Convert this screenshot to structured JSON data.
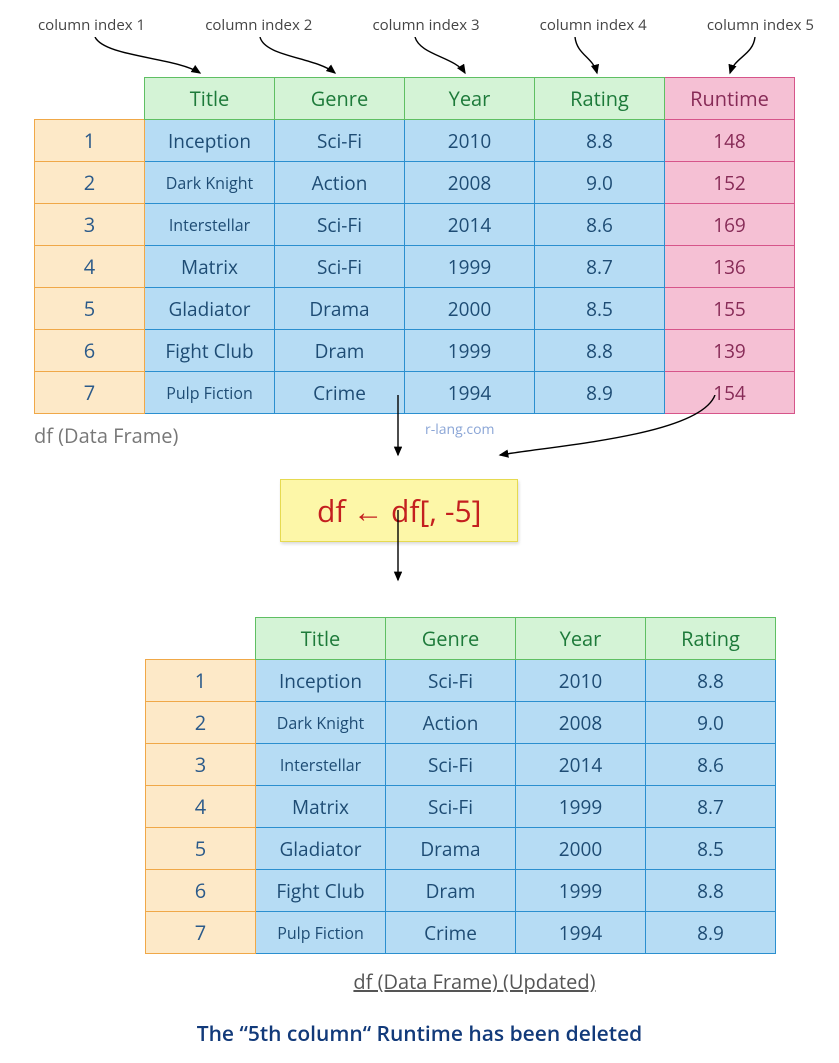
{
  "col_index_labels": [
    "column index 1",
    "column index 2",
    "column index 3",
    "column index 4",
    "column index 5"
  ],
  "table1": {
    "headers": [
      "Title",
      "Genre",
      "Year",
      "Rating",
      "Runtime"
    ],
    "rows": [
      {
        "idx": "1",
        "cells": [
          "Inception",
          "Sci-Fi",
          "2010",
          "8.8",
          "148"
        ]
      },
      {
        "idx": "2",
        "cells": [
          "Dark Knight",
          "Action",
          "2008",
          "9.0",
          "152"
        ]
      },
      {
        "idx": "3",
        "cells": [
          "Interstellar",
          "Sci-Fi",
          "2014",
          "8.6",
          "169"
        ]
      },
      {
        "idx": "4",
        "cells": [
          "Matrix",
          "Sci-Fi",
          "1999",
          "8.7",
          "136"
        ]
      },
      {
        "idx": "5",
        "cells": [
          "Gladiator",
          "Drama",
          "2000",
          "8.5",
          "155"
        ]
      },
      {
        "idx": "6",
        "cells": [
          "Fight Club",
          "Dram",
          "1999",
          "8.8",
          "139"
        ]
      },
      {
        "idx": "7",
        "cells": [
          "Pulp Fiction",
          "Crime",
          "1994",
          "8.9",
          "154"
        ]
      }
    ],
    "caption": "df (Data Frame)"
  },
  "watermark": "r-lang.com",
  "code": "df ← df[, -5]",
  "table2": {
    "headers": [
      "Title",
      "Genre",
      "Year",
      "Rating"
    ],
    "rows": [
      {
        "idx": "1",
        "cells": [
          "Inception",
          "Sci-Fi",
          "2010",
          "8.8"
        ]
      },
      {
        "idx": "2",
        "cells": [
          "Dark Knight",
          "Action",
          "2008",
          "9.0"
        ]
      },
      {
        "idx": "3",
        "cells": [
          "Interstellar",
          "Sci-Fi",
          "2014",
          "8.6"
        ]
      },
      {
        "idx": "4",
        "cells": [
          "Matrix",
          "Sci-Fi",
          "1999",
          "8.7"
        ]
      },
      {
        "idx": "5",
        "cells": [
          "Gladiator",
          "Drama",
          "2000",
          "8.5"
        ]
      },
      {
        "idx": "6",
        "cells": [
          "Fight Club",
          "Dram",
          "1999",
          "8.8"
        ]
      },
      {
        "idx": "7",
        "cells": [
          "Pulp Fiction",
          "Crime",
          "1994",
          "8.9"
        ]
      }
    ],
    "caption": "df (Data Frame) (Updated)"
  },
  "bottom_note": "The “5th column“ Runtime has been deleted",
  "small_cells": [
    "Dark Knight",
    "Interstellar",
    "Pulp Fiction"
  ]
}
